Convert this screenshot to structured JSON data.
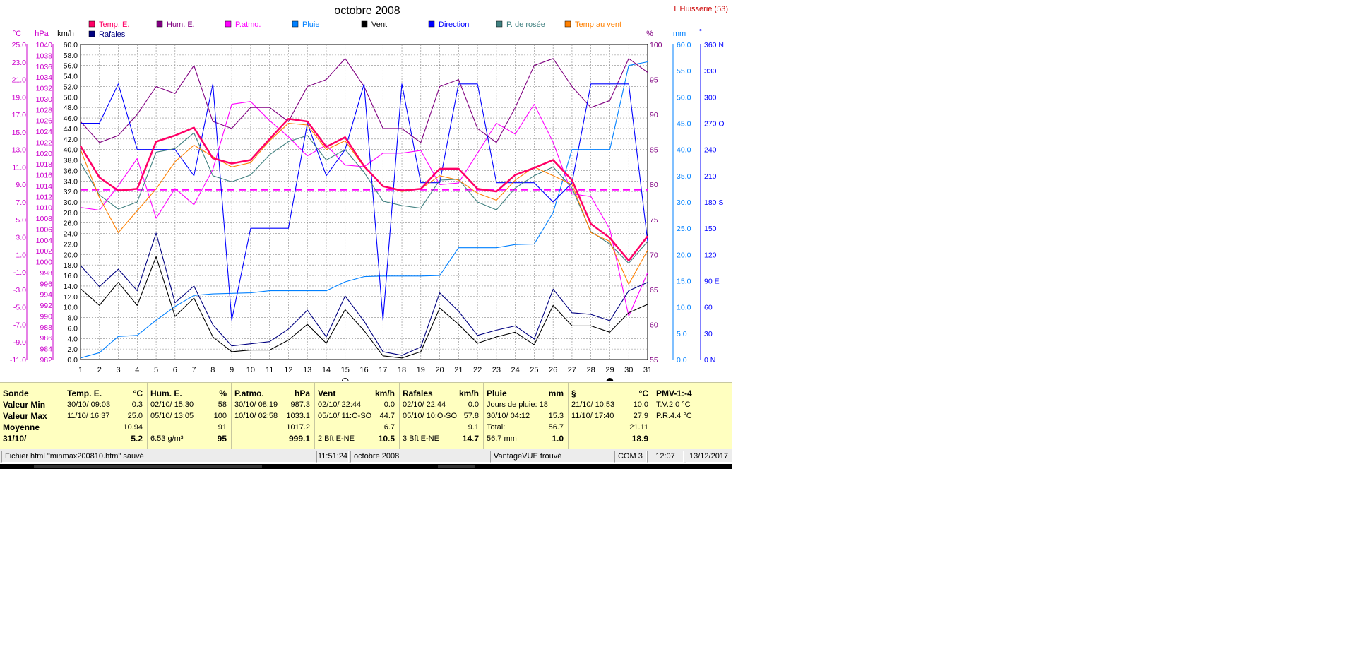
{
  "title": "octobre 2008",
  "station": "L'Huisserie (53)",
  "colors": {
    "temp": "#ff0066",
    "hum": "#800080",
    "pression": "#ff00ff",
    "pluie": "#0080ff",
    "vent": "#000000",
    "direction": "#0000ff",
    "rosee": "#408080",
    "tempvent": "#ff8000",
    "rafales": "#000080",
    "panel": "#ffffc0"
  },
  "legend": [
    {
      "key": "temp",
      "label": "Temp. E."
    },
    {
      "key": "hum",
      "label": "Hum. E."
    },
    {
      "key": "pression",
      "label": "P.atmo."
    },
    {
      "key": "pluie",
      "label": "Pluie"
    },
    {
      "key": "vent",
      "label": "Vent"
    },
    {
      "key": "direction",
      "label": "Direction"
    },
    {
      "key": "rosee",
      "label": "P. de rosée"
    },
    {
      "key": "tempvent",
      "label": "Temp au vent"
    },
    {
      "key": "rafales",
      "label": "Rafales"
    }
  ],
  "axes": {
    "temp": {
      "unit": "°C",
      "min": -11,
      "max": 25,
      "ticks": [
        "25.0",
        "23.0",
        "21.0",
        "19.0",
        "17.0",
        "15.0",
        "13.0",
        "11.0",
        "9.0",
        "7.0",
        "5.0",
        "3.0",
        "1.0",
        "-1.0",
        "-3.0",
        "-5.0",
        "-7.0",
        "-9.0",
        "-11.0"
      ]
    },
    "pression": {
      "unit": "hPa",
      "min": 982,
      "max": 1040,
      "ticks": [
        "1040",
        "1038",
        "1036",
        "1034",
        "1032",
        "1030",
        "1028",
        "1026",
        "1024",
        "1022",
        "1020",
        "1018",
        "1016",
        "1014",
        "1012",
        "1010",
        "1008",
        "1006",
        "1004",
        "1002",
        "1000",
        "998",
        "996",
        "994",
        "992",
        "990",
        "988",
        "986",
        "984",
        "982"
      ]
    },
    "vent": {
      "unit": "km/h",
      "min": 0,
      "max": 60,
      "ticks": [
        "60.0",
        "58.0",
        "56.0",
        "54.0",
        "52.0",
        "50.0",
        "48.0",
        "46.0",
        "44.0",
        "42.0",
        "40.0",
        "38.0",
        "36.0",
        "34.0",
        "32.0",
        "30.0",
        "28.0",
        "26.0",
        "24.0",
        "22.0",
        "20.0",
        "18.0",
        "16.0",
        "14.0",
        "12.0",
        "10.0",
        "8.0",
        "6.0",
        "4.0",
        "2.0",
        "0.0"
      ]
    },
    "hum": {
      "unit": "%",
      "min": 55,
      "max": 100,
      "ticks": [
        "100",
        "95",
        "90",
        "85",
        "80",
        "75",
        "70",
        "65",
        "60",
        "55"
      ]
    },
    "pluie": {
      "unit": "mm",
      "min": 0,
      "max": 60,
      "ticks": [
        "60.0",
        "55.0",
        "50.0",
        "45.0",
        "40.0",
        "35.0",
        "30.0",
        "25.0",
        "20.0",
        "15.0",
        "10.0",
        "5.0",
        "0.0"
      ]
    },
    "direction": {
      "unit": "°",
      "min": 0,
      "max": 360,
      "ticks": [
        "360 N",
        "330",
        "300",
        "270 O",
        "240",
        "210",
        "180 S",
        "150",
        "120",
        "90  E",
        "60",
        "30",
        "0    N"
      ]
    }
  },
  "chart_data": {
    "type": "line",
    "title": "octobre 2008",
    "x": [
      1,
      2,
      3,
      4,
      5,
      6,
      7,
      8,
      9,
      10,
      11,
      12,
      13,
      14,
      15,
      16,
      17,
      18,
      19,
      20,
      21,
      22,
      23,
      24,
      25,
      26,
      27,
      28,
      29,
      30,
      31
    ],
    "series": [
      {
        "name": "Temp. E.",
        "unit": "°C",
        "axis": "temp",
        "values": [
          13.4,
          9.8,
          8.3,
          8.5,
          13.9,
          14.6,
          15.5,
          12.0,
          11.4,
          11.8,
          14.2,
          16.5,
          16.2,
          13.3,
          14.4,
          11.1,
          8.8,
          8.3,
          8.5,
          10.8,
          10.8,
          8.5,
          8.2,
          10.1,
          10.9,
          11.8,
          9.5,
          4.5,
          2.9,
          0.3,
          3.1
        ]
      },
      {
        "name": "Hum. E.",
        "unit": "%",
        "axis": "hum",
        "values": [
          89,
          86,
          87,
          90,
          94,
          93,
          97,
          89,
          88,
          91,
          91,
          89,
          94,
          95,
          98,
          94,
          88,
          88,
          86,
          94,
          95,
          88,
          86,
          91,
          97,
          98,
          94,
          91,
          92,
          98,
          96
        ]
      },
      {
        "name": "P.atmo.",
        "unit": "hPa",
        "axis": "pression",
        "values": [
          1010,
          1009.5,
          1014,
          1019,
          1008,
          1013.5,
          1010.5,
          1017,
          1029,
          1029.5,
          1026,
          1023,
          1019.5,
          1021.5,
          1017.8,
          1017.5,
          1020,
          1020,
          1020.5,
          1014.2,
          1014.5,
          1020,
          1025.5,
          1023.5,
          1029,
          1022,
          1012.5,
          1012,
          1006,
          990,
          998
        ]
      },
      {
        "name": "Pluie",
        "unit": "mm",
        "axis": "pluie",
        "values": [
          0.3,
          1.3,
          4.4,
          4.6,
          7.5,
          10.1,
          12.2,
          12.5,
          12.6,
          12.7,
          13.1,
          13.1,
          13.1,
          13.1,
          14.8,
          15.8,
          15.9,
          15.9,
          15.9,
          16.0,
          21.3,
          21.3,
          21.3,
          21.9,
          22.0,
          28.0,
          40.0,
          40.0,
          40.0,
          56.0,
          56.7
        ]
      },
      {
        "name": "Vent",
        "unit": "km/h",
        "axis": "vent",
        "values": [
          13.5,
          10.3,
          14.7,
          10.3,
          19.6,
          8.2,
          11.7,
          4.3,
          1.5,
          1.8,
          1.8,
          3.7,
          6.7,
          3.1,
          9.5,
          5.5,
          0.7,
          0.3,
          1.5,
          9.8,
          6.7,
          3.1,
          4.3,
          5.2,
          2.8,
          10.3,
          6.4,
          6.4,
          5.2,
          8.9,
          10.5
        ]
      },
      {
        "name": "Direction",
        "unit": "°",
        "axis": "direction",
        "values": [
          270,
          270,
          315,
          240,
          240,
          240,
          210,
          315,
          45,
          150,
          150,
          150,
          270,
          210,
          240,
          315,
          45,
          315,
          202,
          202,
          315,
          315,
          202,
          202,
          202,
          180,
          202,
          315,
          315,
          315,
          135
        ]
      },
      {
        "name": "P. de rosée",
        "unit": "°C",
        "axis": "temp",
        "values": [
          11.5,
          7.8,
          6.2,
          7.0,
          12.7,
          13.1,
          14.9,
          10.0,
          9.3,
          10.1,
          12.4,
          13.9,
          14.6,
          11.8,
          13.0,
          10.4,
          7.1,
          6.6,
          6.3,
          9.5,
          9.6,
          7.0,
          6.1,
          8.6,
          10.0,
          11.0,
          8.6,
          3.6,
          2.2,
          0.0,
          2.5
        ]
      },
      {
        "name": "Temp au vent",
        "unit": "°C",
        "axis": "temp",
        "values": [
          13.0,
          7.5,
          3.5,
          6.0,
          8.5,
          11.6,
          13.5,
          12.2,
          11.0,
          11.5,
          14.0,
          16.0,
          15.8,
          13.0,
          14.0,
          11.0,
          8.8,
          8.2,
          8.5,
          10.0,
          9.5,
          8.0,
          7.2,
          9.5,
          11.0,
          10.0,
          9.0,
          3.5,
          2.5,
          -2.4,
          1.5
        ]
      },
      {
        "name": "Rafales",
        "unit": "km/h",
        "axis": "vent",
        "values": [
          17.9,
          13.9,
          17.2,
          13.1,
          24.1,
          10.8,
          14.0,
          6.6,
          2.6,
          3.0,
          3.4,
          5.8,
          9.4,
          4.3,
          12.1,
          7.3,
          1.5,
          0.8,
          2.4,
          12.7,
          9.2,
          4.6,
          5.6,
          6.4,
          3.9,
          13.4,
          8.9,
          8.6,
          7.4,
          13.1,
          14.7
        ]
      }
    ],
    "reference_line": {
      "axis": "pression",
      "value": 1013.25
    },
    "moon": [
      {
        "day": 15,
        "phase": "new"
      },
      {
        "day": 29,
        "phase": "full"
      }
    ]
  },
  "summary": {
    "sonde": {
      "head": "Sonde",
      "rows": [
        "Valeur Min",
        "Valeur Max",
        "Moyenne",
        "31/10/"
      ]
    },
    "temp": {
      "head": "Temp. E.",
      "unit": "°C",
      "r1": [
        "30/10/  09:03",
        "0.3"
      ],
      "r2": [
        "11/10/  16:37",
        "25.0"
      ],
      "r3": [
        "",
        "10.94"
      ],
      "r4": [
        "",
        "5.2"
      ]
    },
    "hum": {
      "head": "Hum. E.",
      "unit": "%",
      "r1": [
        "02/10/  15:30",
        "58"
      ],
      "r2": [
        "05/10/  13:05",
        "100"
      ],
      "r3": [
        "",
        "91"
      ],
      "r4": [
        "6.53 g/m³",
        "95"
      ]
    },
    "patmo": {
      "head": "P.atmo.",
      "unit": "hPa",
      "r1": [
        "30/10/  08:19",
        "987.3"
      ],
      "r2": [
        "10/10/  02:58",
        "1033.1"
      ],
      "r3": [
        "",
        "1017.2"
      ],
      "r4": [
        "",
        "999.1"
      ]
    },
    "vent": {
      "head": "Vent",
      "unit": "km/h",
      "r1": [
        "02/10/  22:44",
        "0.0"
      ],
      "r2": [
        "05/10/  11:O-SO",
        "44.7"
      ],
      "r3": [
        "",
        "6.7"
      ],
      "r4": [
        "2 Bft E-NE",
        "10.5"
      ]
    },
    "rafales": {
      "head": "Rafales",
      "unit": "km/h",
      "r1": [
        "02/10/  22:44",
        "0.0"
      ],
      "r2": [
        "05/10/  10:O-SO",
        "57.8"
      ],
      "r3": [
        "",
        "9.1"
      ],
      "r4": [
        "3 Bft E-NE",
        "14.7"
      ]
    },
    "pluie": {
      "head": "Pluie",
      "unit": "mm",
      "r1": [
        "Jours de pluie: 18",
        ""
      ],
      "r2": [
        "30/10/  04:12",
        "15.3"
      ],
      "r3": [
        "Total:",
        "56.7"
      ],
      "r4": [
        "56.7 mm",
        "1.0"
      ]
    },
    "s": {
      "head": "§",
      "unit": "°C",
      "r1": [
        "21/10/  10:53",
        "10.0"
      ],
      "r2": [
        "11/10/  17:40",
        "27.9"
      ],
      "r3": [
        "",
        "21.11"
      ],
      "r4": [
        "",
        "18.9"
      ]
    },
    "pmv": {
      "head": "PMV-1:-4",
      "r1": "T.V.2.0 °C",
      "r2": "P.R.4.4 °C"
    }
  },
  "statusbar": {
    "file": "Fichier html  \"minmax200810.htm\"  sauvé",
    "time": "11:51:24",
    "month": "octobre 2008",
    "device": "VantageVUE trouvé",
    "port": "COM 3",
    "clock": "12:07",
    "date": "13/12/2017"
  }
}
